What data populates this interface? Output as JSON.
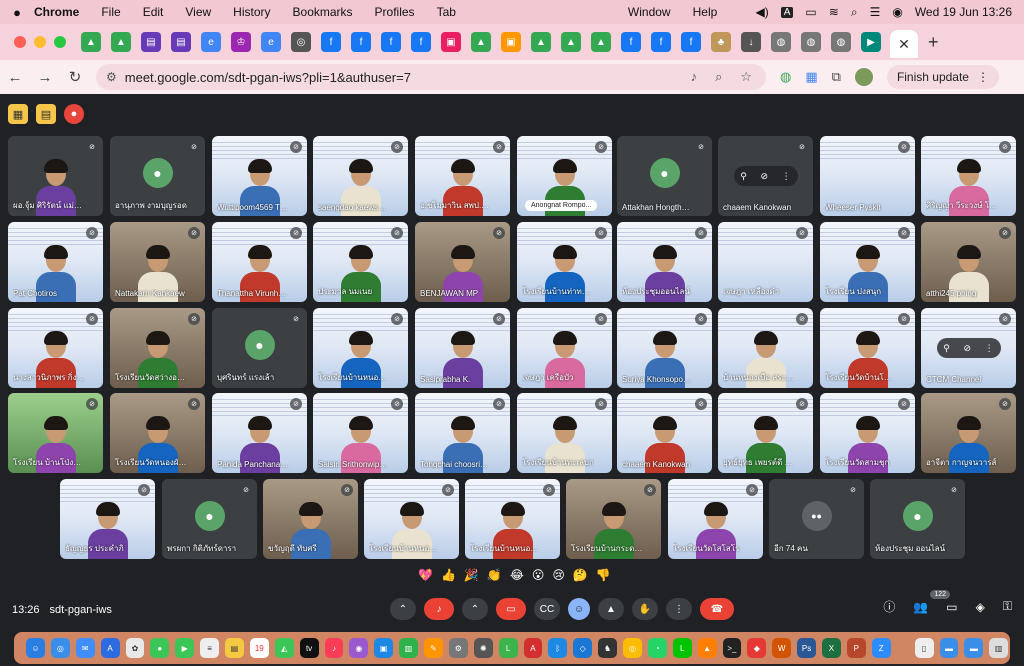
{
  "menubar": {
    "app": "Chrome",
    "items": [
      "File",
      "Edit",
      "View",
      "History",
      "Bookmarks",
      "Profiles",
      "Tab",
      "Window",
      "Help"
    ],
    "input_badge": "A",
    "datetime": "Wed 19 Jun  13:26"
  },
  "browser": {
    "url": "meet.google.com/sdt-pgan-iws?pli=1&authuser=7",
    "finish_update": "Finish update"
  },
  "meeting": {
    "time": "13:26",
    "code": "sdt-pgan-iws",
    "participants_badge": "122",
    "reactions": [
      "💖",
      "👍",
      "🎉",
      "👏",
      "😂",
      "😮",
      "😢",
      "🤔",
      "👎"
    ]
  },
  "tiles": [
    {
      "name": "ผอ.จุ้ม ศิริรัตน์ แม่มยอ...",
      "style": "dark",
      "video": true
    },
    {
      "name": "อานุภาพ งามบุญรอด",
      "style": "dark",
      "avatar": true
    },
    {
      "name": "Wuttipoom4569 Th...",
      "style": "banner",
      "video": true
    },
    {
      "name": "saengdao kaewsai...",
      "style": "banner",
      "video": true
    },
    {
      "name": "อ.ชไมมาวิน สพป.สพ.2",
      "style": "banner",
      "video": true
    },
    {
      "name": "Anongnat Rompo...",
      "style": "banner",
      "video": true,
      "pill": true
    },
    {
      "name": "Attakhan Hongthong",
      "style": "dark",
      "avatar": true
    },
    {
      "name": "chaaem Kanokwan",
      "style": "dark",
      "menu": true
    },
    {
      "name": "Wheeser Pyskit",
      "style": "banner"
    },
    {
      "name": "ศิริญญา วีระวงษ์ โรงเรียน...",
      "style": "banner",
      "video": true
    },
    {
      "name": "Pat Chotiros",
      "style": "banner",
      "video": true
    },
    {
      "name": "Nattakarn Kankaew",
      "style": "room",
      "video": true
    },
    {
      "name": "Thanattha Virunhat...",
      "style": "banner",
      "video": true
    },
    {
      "name": "ประมวล นมเนย",
      "style": "banner",
      "video": true
    },
    {
      "name": "BENJAWAN MP",
      "style": "room",
      "video": true
    },
    {
      "name": "โรงเรียนบ้านท่าทองล่าง",
      "style": "banner",
      "video": true
    },
    {
      "name": "ห้องประชุมออนไลน์",
      "style": "banner",
      "video": true
    },
    {
      "name": "เจษฎา เหลืองดำ",
      "style": "banner"
    },
    {
      "name": "โรงเรียน ปงสนุก",
      "style": "banner",
      "video": true
    },
    {
      "name": "atthi245 phing",
      "style": "room",
      "video": true
    },
    {
      "name": "นางสาวนิภาพร กิ่งแก้ว",
      "style": "banner",
      "video": true
    },
    {
      "name": "โรงเรียนวัดสว่างอารมณ์",
      "style": "room",
      "video": true
    },
    {
      "name": "บุศรินทร์ แรงเล้า",
      "style": "dark",
      "avatar": true
    },
    {
      "name": "โรงเรียนบ้านหนองแสง",
      "style": "banner",
      "video": true
    },
    {
      "name": "Sasiprabha K.",
      "style": "banner",
      "video": true
    },
    {
      "name": "เจษฎา เครือบัว",
      "style": "banner",
      "video": true
    },
    {
      "name": "Suriya Khonsopongdee",
      "style": "banner",
      "video": true
    },
    {
      "name": "บ้านหนองเบือ สระกระโจม",
      "style": "banner",
      "video": true
    },
    {
      "name": "โรงเรียนวัดบ้านโคกกลิ่นรณ์",
      "style": "banner",
      "video": true
    },
    {
      "name": "CTCM Channel",
      "style": "banner",
      "menu": true
    },
    {
      "name": "โรงเรียน บ้านโป่งพร้าว",
      "style": "green",
      "video": true
    },
    {
      "name": "โรงเรียนวัดหนองผักชี",
      "style": "room",
      "video": true
    },
    {
      "name": "Panida Panchanapot",
      "style": "banner",
      "video": true
    },
    {
      "name": "Saisiri Srithonwiphat",
      "style": "banner",
      "video": true
    },
    {
      "name": "Tongchai choosrisuk",
      "style": "banner",
      "video": true
    },
    {
      "name": "โรงเรียนบ้านทะเลบก",
      "style": "banner",
      "video": true
    },
    {
      "name": "chaaem Kanokwan",
      "style": "banner",
      "video": true
    },
    {
      "name": "ยุทธ์ยุทธ เพยรต์ดี รร...",
      "style": "banner",
      "video": true
    },
    {
      "name": "โรงเรียนวัดสามชุก",
      "style": "banner",
      "video": true
    },
    {
      "name": "อาจีตา กาญจนวารส์",
      "style": "room",
      "video": true
    },
    {
      "name": "ธัญญธร ประคำภิ",
      "style": "banner",
      "video": true
    },
    {
      "name": "พรผกา กิติภัทร์ดารา",
      "style": "dark",
      "avatar": true
    },
    {
      "name": "ขวัญฤดี ทับศรี",
      "style": "room",
      "video": true
    },
    {
      "name": "โรงเรียนบ้านหนองกะดี",
      "style": "banner",
      "video": true
    },
    {
      "name": "โรงเรียนบ้านหนองห้วย",
      "style": "banner",
      "video": true
    },
    {
      "name": "โรงเรียนบ้านกระดาน",
      "style": "room",
      "video": true
    },
    {
      "name": "โรงเรียนวัดโสโสโร",
      "style": "banner",
      "video": true
    },
    {
      "name": "อีก 74 คน",
      "style": "dark",
      "others": true
    },
    {
      "name": "ห้องประชุม ออนไลน์",
      "style": "dark",
      "avatar": true
    }
  ]
}
